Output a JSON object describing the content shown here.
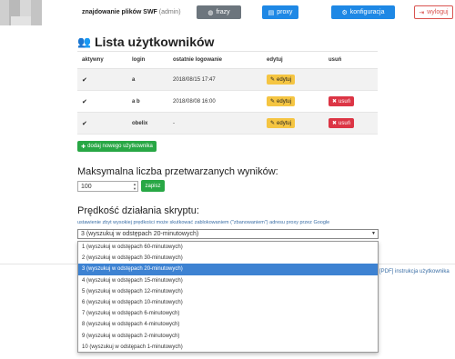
{
  "header": {
    "site_title": "znajdowanie plików SWF",
    "role": "(admin)",
    "buttons": {
      "frazy": "frazy",
      "proxy": "proxy",
      "konfiguracja": "konfiguracja",
      "wyloguj": "wyloguj"
    }
  },
  "users": {
    "title": "Lista użytkowników",
    "columns": [
      "aktywny",
      "login",
      "ostatnie logowanie",
      "edytuj",
      "usuń"
    ],
    "rows": [
      {
        "active": "✔",
        "login": "a",
        "last_login": "2018/08/15 17:47",
        "edit": "edytuj",
        "delete": ""
      },
      {
        "active": "✔",
        "login": "a b",
        "last_login": "2018/08/08 16:00",
        "edit": "edytuj",
        "delete": "usuń"
      },
      {
        "active": "✔",
        "login": "obelix",
        "last_login": "-",
        "edit": "edytuj",
        "delete": "usuń"
      }
    ],
    "add_button": "dodaj nowego użytkownika"
  },
  "max_results": {
    "title": "Maksymalna liczba przetwarzanych wyników:",
    "value": "100",
    "save_button": "zapisz"
  },
  "speed": {
    "title": "Prędkość działania skryptu:",
    "note": "ustawienie zbyt wysokiej prędkości może skutkować zablokowaniem (\"zbanowaniem\") adresu proxy przez Google",
    "selected": "3 (wyszukuj w odstępach 20-minutowych)",
    "options": [
      "1 (wyszukuj w odstępach 60-minutowych)",
      "2 (wyszukuj w odstępach 30-minutowych)",
      "3 (wyszukuj w odstępach 20-minutowych)",
      "4 (wyszukuj w odstępach 15-minutowych)",
      "5 (wyszukuj w odstępach 12-minutowych)",
      "6 (wyszukuj w odstępach 10-minutowych)",
      "7 (wyszukuj w odstępach 6-minutowych)",
      "8 (wyszukuj w odstępach 4-minutowych)",
      "9 (wyszukuj w odstępach 2-minutowych)",
      "10 (wyszukuj w odstępach 1-minutowych)"
    ],
    "selected_index": 2
  },
  "footer": {
    "pdf_link": "[PDF] instrukcja użytkownika"
  }
}
